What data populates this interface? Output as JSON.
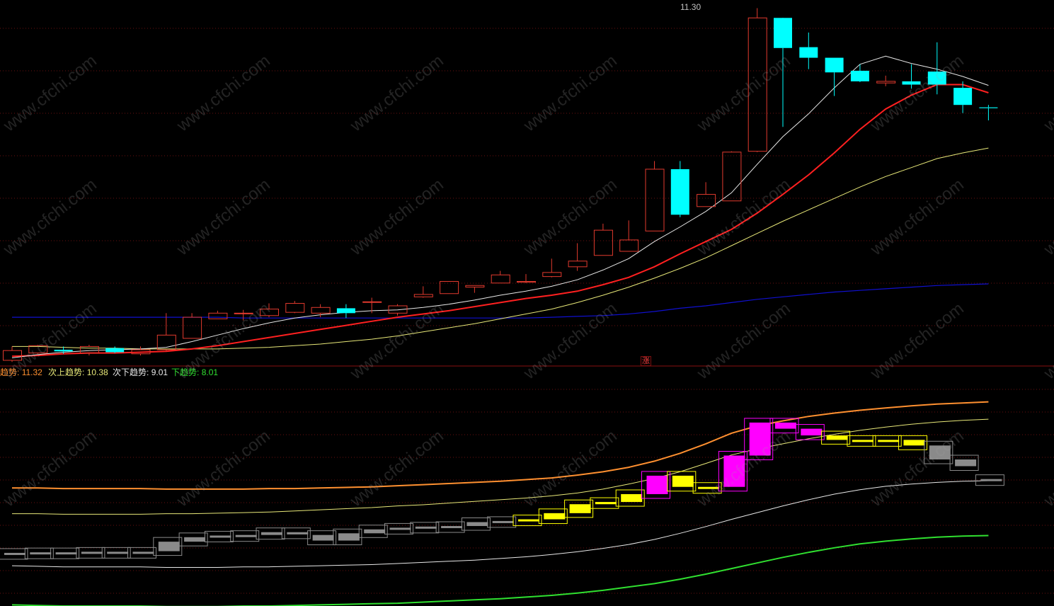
{
  "colors": {
    "up": "#e23a2e",
    "down": "#00ffff",
    "ma_short": "#e8e8e8",
    "ma_mid": "#ff2020",
    "ma_long": "#e8e878",
    "ma_very_long": "#1010d0",
    "trend_upper": "#ff9030",
    "trend_second_upper": "#e8e878",
    "trend_second_lower": "#e8e8e8",
    "trend_lower": "#30e030",
    "box_up_strong": "#ff00ff",
    "box_up": "#ffff00",
    "box_neutral": "#8a8a8a",
    "grid": "#6a1010"
  },
  "price_panel": {
    "high_label": "11.30",
    "marker_label": "涨",
    "ylim": [
      6.9,
      11.4
    ]
  },
  "indicator_panel": {
    "legend": [
      {
        "name_label": "趋势:",
        "value_label": "11.32",
        "color": "#ff9030"
      },
      {
        "name_label": "次上趋势:",
        "value_label": "10.38",
        "color": "#e8e878"
      },
      {
        "name_label": "次下趋势:",
        "value_label": "9.01",
        "color": "#e8e8e8"
      },
      {
        "name_label": "下趋势:",
        "value_label": "8.01",
        "color": "#30e030"
      }
    ],
    "ylim": [
      7.9,
      11.9
    ]
  },
  "watermark": "www.cfchi.com",
  "chart_data": [
    {
      "type": "candlestick",
      "x": [
        1,
        2,
        3,
        4,
        5,
        6,
        7,
        8,
        9,
        10,
        11,
        12,
        13,
        14,
        15,
        16,
        17,
        18,
        19,
        20,
        21,
        22,
        23,
        24,
        25,
        26,
        27,
        28,
        29,
        30,
        31,
        32,
        33,
        34,
        35,
        36,
        37,
        38,
        39
      ],
      "open": [
        6.97,
        7.06,
        7.1,
        7.06,
        7.12,
        7.05,
        7.1,
        7.24,
        7.48,
        7.55,
        7.52,
        7.56,
        7.55,
        7.61,
        7.69,
        7.55,
        7.75,
        7.79,
        7.87,
        7.92,
        7.93,
        8.0,
        8.12,
        8.26,
        8.31,
        8.56,
        9.32,
        8.86,
        8.93,
        9.54,
        11.18,
        10.82,
        10.69,
        10.53,
        10.38,
        10.4,
        10.52,
        10.32,
        10.08
      ],
      "close": [
        7.09,
        7.15,
        7.08,
        7.14,
        7.07,
        7.1,
        7.28,
        7.5,
        7.55,
        7.55,
        7.6,
        7.67,
        7.62,
        7.55,
        7.69,
        7.64,
        7.78,
        7.94,
        7.89,
        8.02,
        7.94,
        8.05,
        8.19,
        8.57,
        8.45,
        9.32,
        8.76,
        9.01,
        9.53,
        11.18,
        10.81,
        10.69,
        10.51,
        10.4,
        10.4,
        10.36,
        10.36,
        10.11,
        10.07
      ],
      "high": [
        7.14,
        7.16,
        7.14,
        7.16,
        7.14,
        7.14,
        7.55,
        7.55,
        7.58,
        7.59,
        7.67,
        7.7,
        7.66,
        7.66,
        7.74,
        7.66,
        7.88,
        7.94,
        7.89,
        8.07,
        8.03,
        8.22,
        8.41,
        8.65,
        8.69,
        9.42,
        9.42,
        9.16,
        9.54,
        11.3,
        11.0,
        11.0,
        10.69,
        10.61,
        10.47,
        10.61,
        10.88,
        10.4,
        10.11
      ],
      "low": [
        6.95,
        7.05,
        7.05,
        7.03,
        7.06,
        7.03,
        7.08,
        7.24,
        7.48,
        7.46,
        7.5,
        7.55,
        7.5,
        7.49,
        7.55,
        7.52,
        7.74,
        7.79,
        7.8,
        7.92,
        7.92,
        7.99,
        8.07,
        8.26,
        8.31,
        8.56,
        8.73,
        8.86,
        8.93,
        9.53,
        9.84,
        10.55,
        10.22,
        10.39,
        10.34,
        10.31,
        10.24,
        10.01,
        9.92
      ],
      "ma_short": [
        7.0,
        7.04,
        7.07,
        7.09,
        7.1,
        7.11,
        7.13,
        7.2,
        7.28,
        7.36,
        7.43,
        7.49,
        7.53,
        7.56,
        7.58,
        7.59,
        7.62,
        7.66,
        7.71,
        7.77,
        7.82,
        7.88,
        7.96,
        8.08,
        8.22,
        8.43,
        8.61,
        8.8,
        9.03,
        9.38,
        9.72,
        10.0,
        10.32,
        10.61,
        10.71,
        10.62,
        10.55,
        10.46,
        10.35
      ],
      "ma_mid": [
        7.02,
        7.03,
        7.05,
        7.06,
        7.06,
        7.07,
        7.08,
        7.11,
        7.15,
        7.2,
        7.25,
        7.3,
        7.35,
        7.4,
        7.45,
        7.5,
        7.54,
        7.58,
        7.63,
        7.68,
        7.73,
        7.77,
        7.82,
        7.9,
        7.99,
        8.12,
        8.28,
        8.43,
        8.58,
        8.78,
        9.01,
        9.25,
        9.52,
        9.81,
        10.06,
        10.23,
        10.36,
        10.36,
        10.26
      ],
      "ma_long": [
        7.14,
        7.14,
        7.13,
        7.12,
        7.12,
        7.11,
        7.11,
        7.11,
        7.11,
        7.12,
        7.13,
        7.15,
        7.17,
        7.2,
        7.23,
        7.27,
        7.32,
        7.37,
        7.42,
        7.48,
        7.54,
        7.6,
        7.68,
        7.77,
        7.87,
        7.98,
        8.1,
        8.23,
        8.38,
        8.53,
        8.68,
        8.82,
        8.96,
        9.1,
        9.23,
        9.34,
        9.45,
        9.52,
        9.58
      ],
      "ma_very_long": [
        7.5,
        7.5,
        7.5,
        7.5,
        7.5,
        7.5,
        7.5,
        7.5,
        7.5,
        7.49,
        7.49,
        7.49,
        7.49,
        7.49,
        7.49,
        7.49,
        7.49,
        7.49,
        7.49,
        7.49,
        7.49,
        7.5,
        7.51,
        7.52,
        7.54,
        7.57,
        7.61,
        7.64,
        7.68,
        7.72,
        7.75,
        7.78,
        7.81,
        7.83,
        7.85,
        7.87,
        7.89,
        7.9,
        7.91
      ]
    },
    {
      "type": "line+boxes",
      "x": [
        1,
        2,
        3,
        4,
        5,
        6,
        7,
        8,
        9,
        10,
        11,
        12,
        13,
        14,
        15,
        16,
        17,
        18,
        19,
        20,
        21,
        22,
        23,
        24,
        25,
        26,
        27,
        28,
        29,
        30,
        31,
        32,
        33,
        34,
        35,
        36,
        37,
        38,
        39
      ],
      "trend_upper": [
        10.01,
        10.01,
        10.0,
        10.0,
        10.0,
        10.0,
        9.99,
        9.99,
        9.99,
        9.99,
        10.0,
        10.0,
        10.01,
        10.02,
        10.03,
        10.05,
        10.07,
        10.09,
        10.11,
        10.13,
        10.16,
        10.19,
        10.24,
        10.3,
        10.38,
        10.49,
        10.63,
        10.8,
        10.99,
        11.12,
        11.21,
        11.29,
        11.35,
        11.4,
        11.44,
        11.48,
        11.51,
        11.53,
        11.55
      ],
      "trend_second_upper": [
        9.55,
        9.55,
        9.54,
        9.54,
        9.54,
        9.54,
        9.55,
        9.55,
        9.56,
        9.57,
        9.58,
        9.6,
        9.62,
        9.64,
        9.66,
        9.69,
        9.71,
        9.74,
        9.77,
        9.8,
        9.83,
        9.87,
        9.92,
        9.99,
        10.08,
        10.18,
        10.3,
        10.45,
        10.6,
        10.71,
        10.8,
        10.89,
        10.97,
        11.04,
        11.1,
        11.15,
        11.19,
        11.22,
        11.24
      ],
      "trend_second_lower": [
        8.62,
        8.61,
        8.6,
        8.6,
        8.6,
        8.6,
        8.59,
        8.59,
        8.59,
        8.6,
        8.6,
        8.61,
        8.62,
        8.63,
        8.64,
        8.66,
        8.68,
        8.7,
        8.72,
        8.75,
        8.78,
        8.82,
        8.87,
        8.93,
        9.0,
        9.09,
        9.2,
        9.32,
        9.45,
        9.57,
        9.69,
        9.8,
        9.9,
        9.98,
        10.04,
        10.08,
        10.11,
        10.13,
        10.14
      ],
      "trend_lower": [
        7.92,
        7.91,
        7.9,
        7.9,
        7.9,
        7.9,
        7.89,
        7.89,
        7.89,
        7.9,
        7.9,
        7.91,
        7.92,
        7.93,
        7.94,
        7.95,
        7.97,
        7.99,
        8.01,
        8.03,
        8.06,
        8.09,
        8.13,
        8.18,
        8.24,
        8.3,
        8.38,
        8.47,
        8.57,
        8.67,
        8.77,
        8.86,
        8.94,
        9.01,
        9.06,
        9.1,
        9.13,
        9.15,
        9.16
      ],
      "box_open": [
        8.84,
        8.85,
        8.86,
        8.87,
        8.87,
        8.86,
        8.88,
        9.05,
        9.13,
        9.16,
        9.17,
        9.22,
        9.17,
        9.07,
        9.2,
        9.27,
        9.3,
        9.32,
        9.33,
        9.4,
        9.42,
        9.45,
        9.56,
        9.72,
        9.76,
        9.9,
        10.23,
        10.03,
        10.03,
        10.59,
        11.18,
        11.07,
        10.95,
        10.87,
        10.86,
        10.87,
        10.77,
        10.52,
        10.15
      ],
      "box_close": [
        8.85,
        8.86,
        8.86,
        8.87,
        8.86,
        8.87,
        9.05,
        9.13,
        9.16,
        9.17,
        9.22,
        9.18,
        9.07,
        9.2,
        9.27,
        9.3,
        9.32,
        9.33,
        9.4,
        9.42,
        9.45,
        9.56,
        9.72,
        9.76,
        9.9,
        10.23,
        10.03,
        10.03,
        10.59,
        11.18,
        11.07,
        10.95,
        10.87,
        10.86,
        10.87,
        10.77,
        10.52,
        10.4,
        10.17
      ],
      "box_color": [
        "neutral",
        "neutral",
        "neutral",
        "neutral",
        "neutral",
        "neutral",
        "neutral",
        "neutral",
        "neutral",
        "neutral",
        "neutral",
        "neutral",
        "neutral",
        "neutral",
        "neutral",
        "neutral",
        "neutral",
        "neutral",
        "neutral",
        "neutral",
        "up",
        "up",
        "up",
        "up",
        "up",
        "strong",
        "up",
        "up",
        "strong",
        "strong",
        "strong",
        "strong",
        "up",
        "up",
        "up",
        "up",
        "neutral",
        "neutral",
        "neutral"
      ]
    }
  ]
}
